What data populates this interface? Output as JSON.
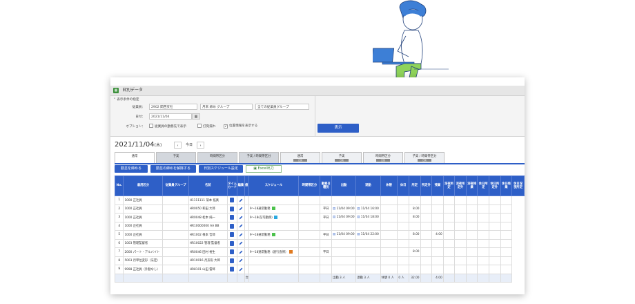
{
  "window": {
    "title": "日別データ"
  },
  "conditions": {
    "header": "表示条件の指定",
    "company_label": "従業員：",
    "company_value": "2902 関西支社",
    "closing_value": "月末 締め グループ",
    "group_value": "全ての従業員グループ",
    "date_label": "日付：",
    "date_value": "2021/11/04",
    "options_label": "オプション：",
    "opt1": "従業員の勤務先で表示",
    "opt2": "打刻漏れ",
    "opt3": "位置情報を表示する",
    "opt3_checked": "✔",
    "show_button": "表示"
  },
  "date_bar": {
    "date": "2021/11/04",
    "dow": "(木)",
    "prev": "‹",
    "today": "今日",
    "next": "›"
  },
  "tabs": [
    {
      "label": "通常",
      "sub": ""
    },
    {
      "label": "予実",
      "sub": ""
    },
    {
      "label": "時間帯区分",
      "sub": ""
    },
    {
      "label": "予実 / 時間帯区分",
      "sub": ""
    },
    {
      "label": "通常",
      "sub": "日別"
    },
    {
      "label": "予実",
      "sub": "日別"
    },
    {
      "label": "時間帯区分",
      "sub": "日別"
    },
    {
      "label": "予実 / 時間帯区分",
      "sub": "日別"
    }
  ],
  "actions": {
    "close_button": "勤怠を締める",
    "unclose_button": "勤怠の締めを解除する",
    "schedule_button": "日別スケジュール設定",
    "excel_button": "Excel出力"
  },
  "table": {
    "headers": [
      "No.",
      "雇用区分",
      "従業員グループ",
      "名前",
      "タイムカード",
      "編集",
      "値",
      "スケジュール",
      "時間帯区分",
      "勤務日種別",
      "出勤",
      "退勤",
      "休憩",
      "休日",
      "所定",
      "所定外",
      "残業",
      "深夜所定",
      "深夜所定外",
      "深夜残業",
      "休日所定",
      "休日所定外",
      "休日残業",
      "休日深夜所定"
    ],
    "rows": [
      {
        "no": "1",
        "type": "1000 正社員",
        "group": "",
        "name": "H1111111 菊本 拓真",
        "schedule": "",
        "color": "",
        "kind": "",
        "in": "",
        "out": "",
        "shotei": "",
        "zangyo": ""
      },
      {
        "no": "2",
        "type": "1000 正社員",
        "group": "",
        "name": "HR0050 和田 大郎",
        "schedule": "9～18通常勤務",
        "color": "#4cc24c",
        "kind": "平日",
        "in": "11/04 09:00",
        "out": "11/04 16:00",
        "shotei": "8.00",
        "zangyo": ""
      },
      {
        "no": "3",
        "type": "1000 正社員",
        "group": "",
        "name": "HR0048 松本 純一",
        "schedule": "9～18(在宅勤務)",
        "color": "#29a8e0",
        "kind": "平日",
        "in": "11/04 09:00",
        "out": "11/04 18:00",
        "shotei": "8.00",
        "zangyo": ""
      },
      {
        "no": "4",
        "type": "1000 正社員",
        "group": "",
        "name": "HR10000000 AA BB",
        "schedule": "",
        "color": "",
        "kind": "",
        "in": "",
        "out": "",
        "shotei": "",
        "zangyo": ""
      },
      {
        "no": "5",
        "type": "1000 正社員",
        "group": "",
        "name": "HR1002 根本 哲郎",
        "schedule": "9～18通常勤務",
        "color": "#4cc24c",
        "kind": "平日",
        "in": "11/04 09:00",
        "out": "11/04 22:00",
        "shotei": "8.00",
        "zangyo": "4.00"
      },
      {
        "no": "6",
        "type": "1003 管理監督者",
        "group": "",
        "name": "HR10022 管理 監督者",
        "schedule": "",
        "color": "",
        "kind": "",
        "in": "",
        "out": "",
        "shotei": "",
        "zangyo": ""
      },
      {
        "no": "7",
        "type": "2000 パート・アルバイト",
        "group": "",
        "name": "HR0046 田村 裕生",
        "schedule": "9～18通常勤務（遅行直帰）",
        "color": "#e07a20",
        "kind": "平日",
        "in": "",
        "out": "",
        "shotei": "8.00",
        "zangyo": ""
      },
      {
        "no": "8",
        "type": "5003 月単位変形（法定）",
        "group": "",
        "name": "HR10016 月形形 大郎",
        "schedule": "",
        "color": "",
        "kind": "",
        "in": "",
        "out": "",
        "shotei": "",
        "zangyo": ""
      },
      {
        "no": "9",
        "type": "9998 正社員（外勤なし）",
        "group": "",
        "name": "HR8101 山田 雷郎",
        "schedule": "",
        "color": "",
        "kind": "",
        "in": "",
        "out": "",
        "shotei": "",
        "zangyo": ""
      }
    ],
    "summary": {
      "label": "合計",
      "in": "出勤 3 人",
      "out": "退勤 3 人",
      "rest": "休憩 0 人",
      "kyujitsu": "0 人",
      "shotei": "32.00",
      "zangyo": "4.00"
    }
  },
  "colors": {
    "accent": "#2e5fc7",
    "header_bg": "#2e5fc7"
  }
}
